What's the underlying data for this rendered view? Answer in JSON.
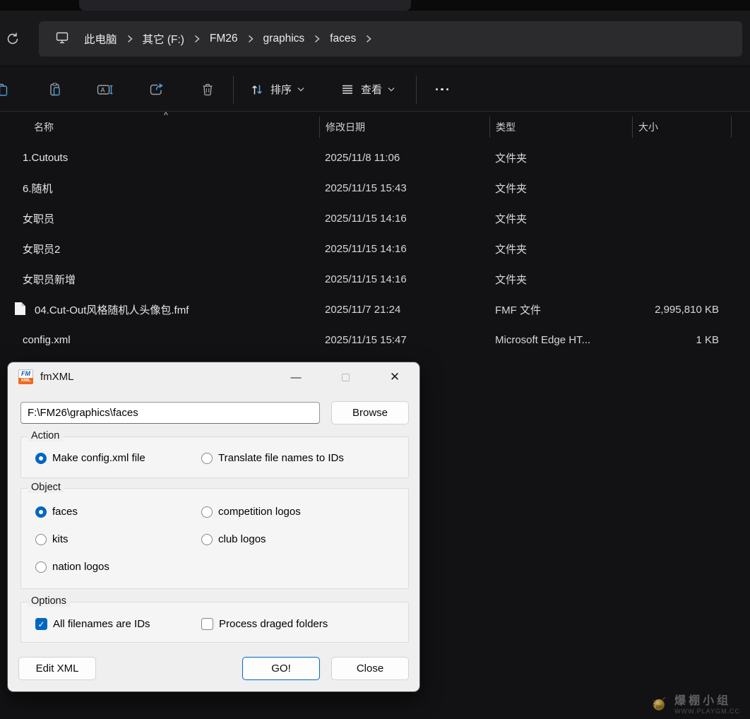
{
  "explorer": {
    "breadcrumb": {
      "items": [
        "此电脑",
        "其它 (F:)",
        "FM26",
        "graphics",
        "faces"
      ]
    },
    "toolbar": {
      "sort_label": "排序",
      "view_label": "查看",
      "icons": [
        "copy",
        "paste",
        "rename",
        "share",
        "delete",
        "sort",
        "view",
        "more"
      ]
    },
    "list": {
      "columns": {
        "name": "名称",
        "date": "修改日期",
        "type": "类型",
        "size": "大小"
      },
      "sort_caret": "^",
      "rows": [
        {
          "icon": "folder",
          "name": "1.Cutouts",
          "date": "2025/11/8 11:06",
          "type": "文件夹",
          "size": ""
        },
        {
          "icon": "folder",
          "name": "6.随机",
          "date": "2025/11/15 15:43",
          "type": "文件夹",
          "size": ""
        },
        {
          "icon": "folder",
          "name": "女职员",
          "date": "2025/11/15 14:16",
          "type": "文件夹",
          "size": ""
        },
        {
          "icon": "folder",
          "name": "女职员2",
          "date": "2025/11/15 14:16",
          "type": "文件夹",
          "size": ""
        },
        {
          "icon": "folder",
          "name": "女职员新增",
          "date": "2025/11/15 14:16",
          "type": "文件夹",
          "size": ""
        },
        {
          "icon": "file",
          "name": "04.Cut-Out风格随机人头像包.fmf",
          "date": "2025/11/7 21:24",
          "type": "FMF 文件",
          "size": "2,995,810 KB"
        },
        {
          "icon": "edge",
          "name": "config.xml",
          "date": "2025/11/15 15:47",
          "type": "Microsoft Edge HT...",
          "size": "1 KB"
        }
      ]
    }
  },
  "dialog": {
    "title": "fmXML",
    "app_icon": {
      "top": "FM",
      "bottom": "XML"
    },
    "path_field": {
      "value": "F:\\FM26\\graphics\\faces"
    },
    "browse_label": "Browse",
    "groups": {
      "action": {
        "label": "Action",
        "radios": [
          {
            "label": "Make config.xml file",
            "selected": true
          },
          {
            "label": "Translate file names to IDs",
            "selected": false
          }
        ]
      },
      "object": {
        "label": "Object",
        "radios": [
          {
            "label": "faces",
            "selected": true
          },
          {
            "label": "kits",
            "selected": false
          },
          {
            "label": "nation logos",
            "selected": false
          },
          {
            "label": "competition logos",
            "selected": false
          },
          {
            "label": "club logos",
            "selected": false
          }
        ]
      },
      "options": {
        "label": "Options",
        "checks": [
          {
            "label": "All filenames are IDs",
            "checked": true
          },
          {
            "label": "Process draged folders",
            "checked": false
          }
        ]
      }
    },
    "buttons": {
      "edit_xml": "Edit XML",
      "go": "GO!",
      "close": "Close"
    }
  },
  "watermark": {
    "name": "爆棚小组",
    "site": "WWW.PLAYGM.CC"
  },
  "colors": {
    "accent": "#0067c0",
    "folder_yellow": "#fcc24d",
    "icon_blue": "#4f9cd8"
  }
}
